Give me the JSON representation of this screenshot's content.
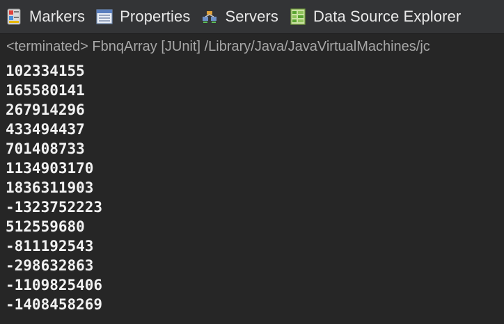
{
  "tabs": [
    {
      "label": "Markers",
      "icon": "markers-icon"
    },
    {
      "label": "Properties",
      "icon": "properties-icon"
    },
    {
      "label": "Servers",
      "icon": "servers-icon"
    },
    {
      "label": "Data Source Explorer",
      "icon": "data-source-explorer-icon"
    }
  ],
  "console": {
    "status": "<terminated> FbnqArray [JUnit] /Library/Java/JavaVirtualMachines/jc",
    "output": [
      "102334155",
      "165580141",
      "267914296",
      "433494437",
      "701408733",
      "1134903170",
      "1836311903",
      "-1323752223",
      "512559680",
      "-811192543",
      "-298632863",
      "-1109825406",
      "-1408458269"
    ]
  },
  "colors": {
    "tabbar_background": "#333436",
    "console_background": "#262626",
    "output_text": "#f2f2f2",
    "status_text": "#a7a7a7"
  }
}
